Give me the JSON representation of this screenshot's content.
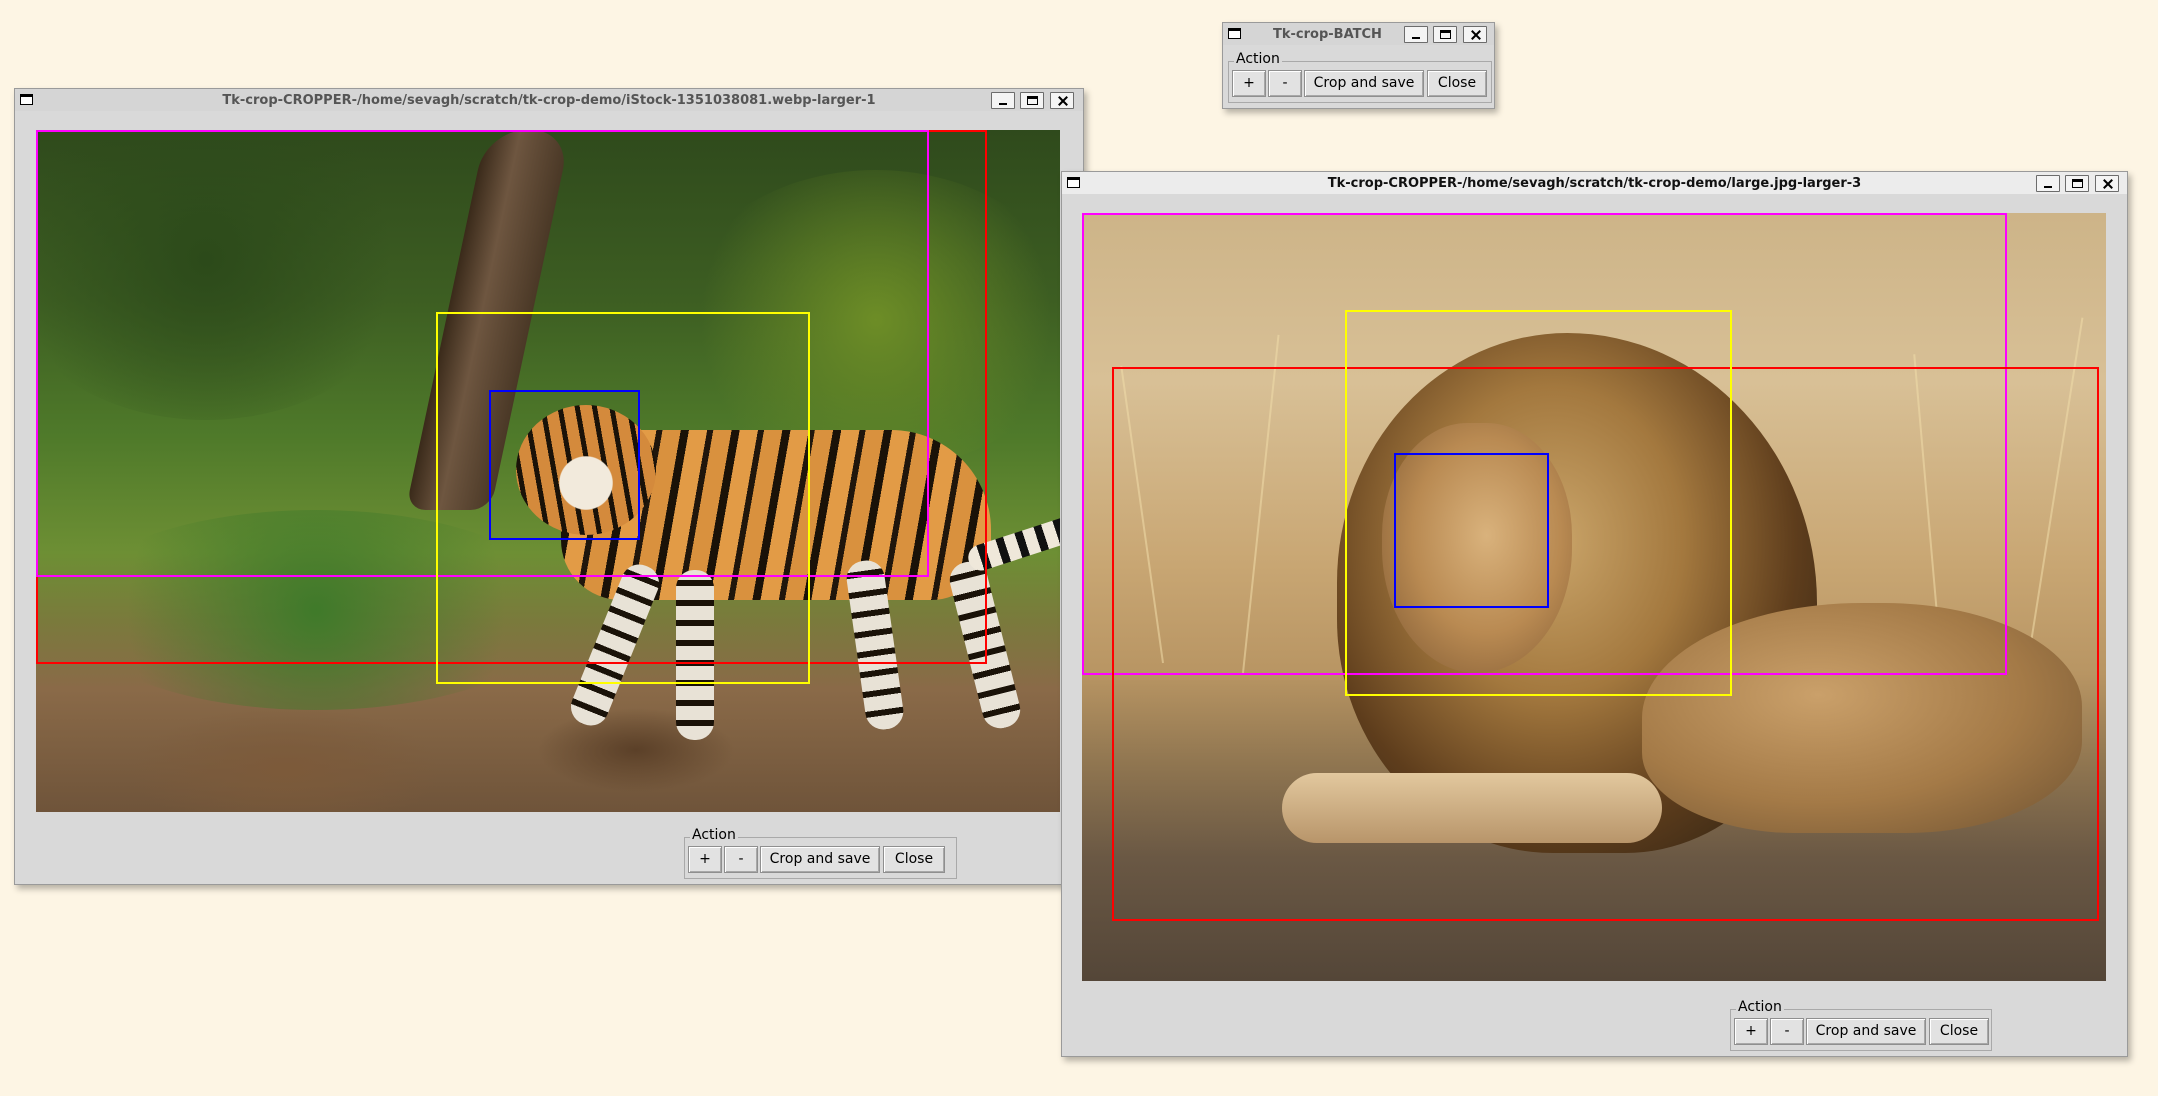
{
  "batch_window": {
    "title": "Tk-crop-BATCH",
    "group_label": "Action",
    "buttons": {
      "plus": "+",
      "minus": "-",
      "crop_save": "Crop and save",
      "close": "Close"
    }
  },
  "tiger_window": {
    "title": "Tk-crop-CROPPER-/home/sevagh/scratch/tk-crop-demo/iStock-1351038081.webp-larger-1",
    "group_label": "Action",
    "buttons": {
      "plus": "+",
      "minus": "-",
      "crop_save": "Crop and save",
      "close": "Close"
    }
  },
  "lion_window": {
    "title": "Tk-crop-CROPPER-/home/sevagh/scratch/tk-crop-demo/large.jpg-larger-3",
    "group_label": "Action",
    "buttons": {
      "plus": "+",
      "minus": "-",
      "crop_save": "Crop and save",
      "close": "Close"
    }
  },
  "colors": {
    "desktop": "#fdf5e4",
    "crop_red": "#ff0000",
    "crop_magenta": "#ff00ff",
    "crop_yellow": "#ffff00",
    "crop_blue": "#0000ff"
  }
}
